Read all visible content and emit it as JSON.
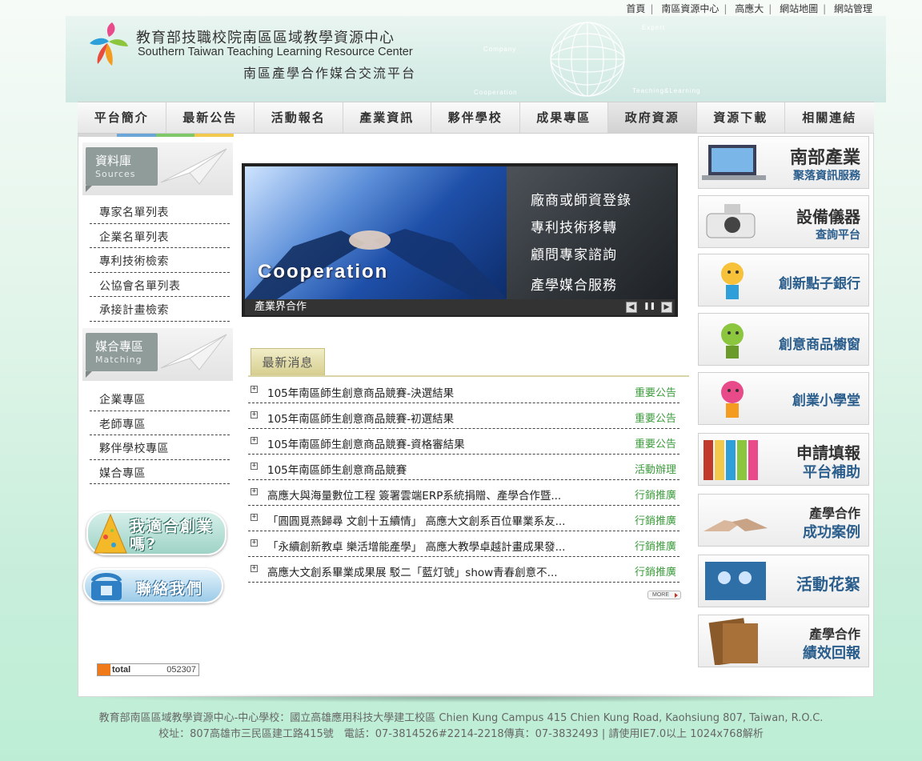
{
  "top_links": [
    "首頁",
    "南區資源中心",
    "高應大",
    "網站地圖",
    "網站管理"
  ],
  "header": {
    "title_zh": "教育部技職校院南區區域教學資源中心",
    "title_en": "Southern Taiwan Teaching Learning Resource Center",
    "subtitle": "南區產學合作媒合交流平台",
    "globe_labels": [
      "Expert",
      "Company",
      "Cooperation",
      "Teaching&Learning"
    ]
  },
  "nav": [
    "平台簡介",
    "最新公告",
    "活動報名",
    "產業資訊",
    "夥伴學校",
    "成果專區",
    "政府資源",
    "資源下載",
    "相關連結"
  ],
  "sidebar": {
    "sources": {
      "title": "資料庫",
      "subtitle": "Sources",
      "items": [
        "專家名單列表",
        "企業名單列表",
        "專利技術檢索",
        "公協會名單列表",
        "承接計畫檢索"
      ]
    },
    "matching": {
      "title": "媒合專區",
      "subtitle": "Matching",
      "items": [
        "企業專區",
        "老師專區",
        "夥伴學校專區",
        "媒合專區"
      ]
    },
    "promo1": "我適合創業嗎?",
    "promo2": "聯絡我們",
    "counter_label": "total",
    "counter_value": "052307"
  },
  "banner": {
    "image_text": "Cooperation",
    "services": [
      "廠商或師資登錄",
      "專利技術移轉",
      "顧問專家諮詢",
      "產學媒合服務"
    ],
    "caption": "產業界合作"
  },
  "news": {
    "tab": "最新消息",
    "items": [
      {
        "title": "105年南區師生創意商品競賽-決選結果",
        "category": "重要公告"
      },
      {
        "title": "105年南區師生創意商品競賽-初選結果",
        "category": "重要公告"
      },
      {
        "title": "105年南區師生創意商品競賽-資格審結果",
        "category": "重要公告"
      },
      {
        "title": "105年南區師生創意商品競賽",
        "category": "活動辦理"
      },
      {
        "title": "高應大與海量數位工程 簽署雲端ERP系統捐贈、產學合作暨...",
        "category": "行銷推廣"
      },
      {
        "title": "「圓圓覓燕歸尋 文創十五續情」 高應大文創系百位畢業系友...",
        "category": "行銷推廣"
      },
      {
        "title": "「永續創新教卓 樂活增能產學」 高應大教學卓越計畫成果發...",
        "category": "行銷推廣"
      },
      {
        "title": "高應大文創系畢業成果展 駁二「藍灯號」show青春創意不...",
        "category": "行銷推廣"
      }
    ],
    "more": "MORE"
  },
  "right_cards": [
    {
      "l1": "南部產業",
      "l2": "聚落資訊服務"
    },
    {
      "l1": "設備儀器",
      "l2": "查詢平台"
    },
    {
      "l1": "創新點子銀行",
      "l2": ""
    },
    {
      "l1": "創意商品櫥窗",
      "l2": ""
    },
    {
      "l1": "創業小學堂",
      "l2": ""
    },
    {
      "l1": "申請填報",
      "l2": "平台補助"
    },
    {
      "l1": "產學合作",
      "l2": "成功案例"
    },
    {
      "l1": "活動花絮",
      "l2": ""
    },
    {
      "l1": "產學合作",
      "l2": "績效回報"
    }
  ],
  "footer": {
    "line1": "教育部南區區域教學資源中心-中心學校：國立高雄應用科技大學建工校區 Chien Kung Campus 415 Chien Kung Road, Kaohsiung 807, Taiwan, R.O.C.",
    "line2": "校址：807高雄市三民區建工路415號　電話：07-3814526#2214-2218傳真：07-3832493 | 請使用IE7.0以上 1024x768解析"
  },
  "colors": {
    "accent_green": "#3b9b3b",
    "nav_bg": "#e6e6e6",
    "side_tab": "#909c9a",
    "page_bg": "#c8eedb"
  }
}
